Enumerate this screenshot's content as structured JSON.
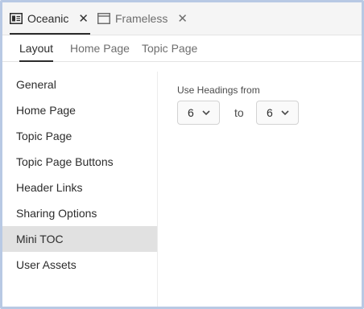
{
  "doc_tabs": [
    {
      "label": "Oceanic",
      "icon": "panel-icon",
      "active": true
    },
    {
      "label": "Frameless",
      "icon": "window-icon",
      "active": false
    }
  ],
  "sub_tabs": [
    {
      "label": "Layout",
      "active": true
    },
    {
      "label": "Home Page",
      "active": false
    },
    {
      "label": "Topic Page",
      "active": false
    }
  ],
  "sidebar": {
    "items": [
      {
        "label": "General"
      },
      {
        "label": "Home Page"
      },
      {
        "label": "Topic Page"
      },
      {
        "label": "Topic Page Buttons"
      },
      {
        "label": "Header Links"
      },
      {
        "label": "Sharing Options"
      },
      {
        "label": "Mini TOC",
        "selected": true
      },
      {
        "label": "User Assets"
      }
    ]
  },
  "main": {
    "use_headings_label": "Use Headings from",
    "from_value": "6",
    "to_label": "to",
    "to_value": "6"
  },
  "colors": {
    "window_border": "#b8c9e4",
    "selected_item_bg": "#e1e1e1",
    "tab_bar_bg": "#f5f5f5"
  }
}
